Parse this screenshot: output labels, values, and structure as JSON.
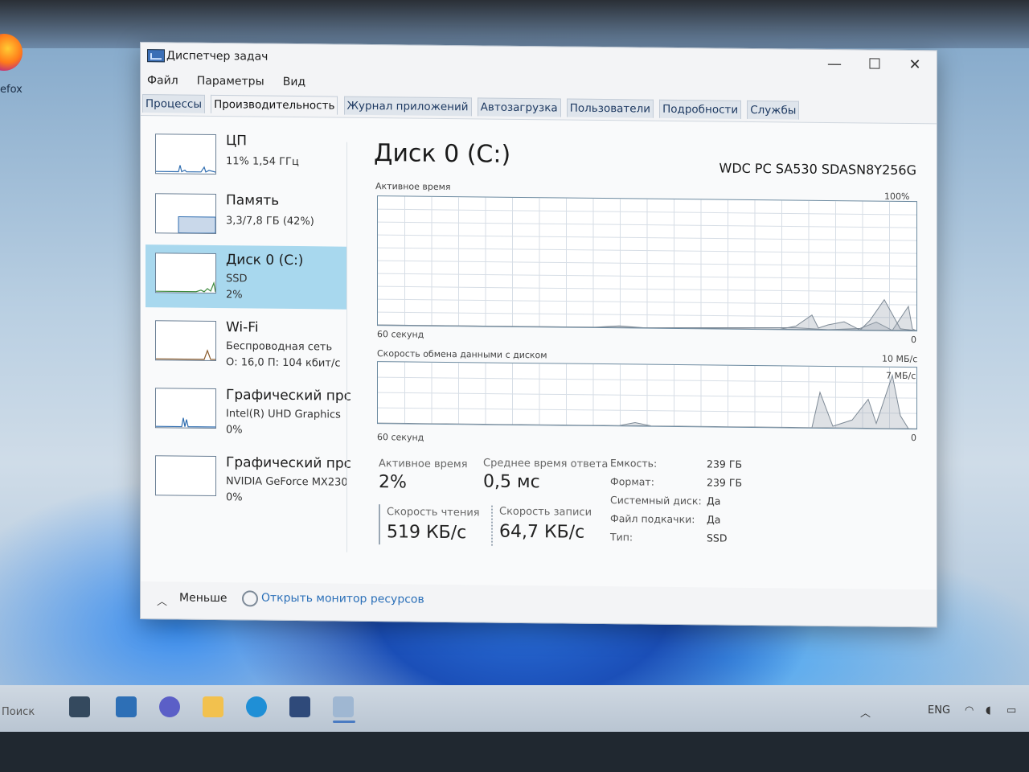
{
  "desktop": {
    "icon_label": "efox"
  },
  "window": {
    "title": "Диспетчер задач",
    "controls": {
      "minimize": "—",
      "maximize": "☐",
      "close": "✕"
    }
  },
  "menu": [
    "Файл",
    "Параметры",
    "Вид"
  ],
  "tabs": [
    "Процессы",
    "Производительность",
    "Журнал приложений",
    "Автозагрузка",
    "Пользователи",
    "Подробности",
    "Службы"
  ],
  "active_tab": "Производительность",
  "perf_list": [
    {
      "title": "ЦП",
      "line1": "11%  1,54 ГГц",
      "line2": ""
    },
    {
      "title": "Память",
      "line1": "3,3/7,8 ГБ (42%)",
      "line2": ""
    },
    {
      "title": "Диск 0 (C:)",
      "line1": "SSD",
      "line2": "2%"
    },
    {
      "title": "Wi-Fi",
      "line1": "Беспроводная сеть",
      "line2": "О: 16,0  П: 104 кбит/с"
    },
    {
      "title": "Графический прс",
      "line1": "Intel(R) UHD Graphics",
      "line2": "0%"
    },
    {
      "title": "Графический прс",
      "line1": "NVIDIA GeForce MX230",
      "line2": "0%"
    }
  ],
  "disk": {
    "title": "Диск 0 (C:)",
    "model": "WDC PC SA530 SDASN8Y256G",
    "graph1": {
      "label": "Активное время",
      "max": "100%",
      "time": "60 секунд",
      "min": "0"
    },
    "graph2": {
      "label": "Скорость обмена данными с диском",
      "max": "10 МБ/с",
      "inner": "7 МБ/с",
      "time": "60 секунд",
      "min": "0"
    },
    "stats": {
      "active_label": "Активное время",
      "active_value": "2%",
      "resp_label": "Среднее время ответа",
      "resp_value": "0,5 мс",
      "read_label": "Скорость чтения",
      "read_value": "519 КБ/с",
      "write_label": "Скорость записи",
      "write_value": "64,7 КБ/с"
    },
    "props": [
      {
        "k": "Емкость:",
        "v": "239 ГБ"
      },
      {
        "k": "Формат:",
        "v": "239 ГБ"
      },
      {
        "k": "Системный диск:",
        "v": "Да"
      },
      {
        "k": "Файл подкачки:",
        "v": "Да"
      },
      {
        "k": "Тип:",
        "v": "SSD"
      }
    ]
  },
  "footer": {
    "less": "Меньше",
    "monitor": "Открыть монитор ресурсов"
  },
  "taskbar": {
    "search": "Поиск",
    "lang": "ENG"
  }
}
